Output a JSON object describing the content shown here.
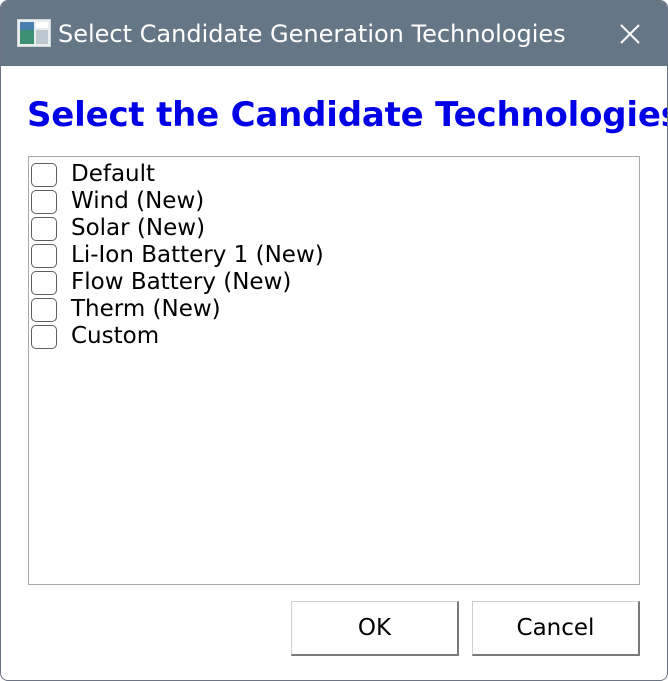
{
  "window": {
    "title": "Select Candidate Generation Technologies",
    "app_icon": "app-window-icon",
    "close_icon": "close-icon"
  },
  "heading": "Select the Candidate Technologies",
  "heading_color": "#0000e6",
  "technologies": [
    {
      "label": "Default",
      "checked": false
    },
    {
      "label": "Wind (New)",
      "checked": false
    },
    {
      "label": "Solar (New)",
      "checked": false
    },
    {
      "label": "Li-Ion Battery 1 (New)",
      "checked": false
    },
    {
      "label": "Flow Battery (New)",
      "checked": false
    },
    {
      "label": "Therm (New)",
      "checked": false
    },
    {
      "label": "Custom",
      "checked": false
    }
  ],
  "buttons": {
    "ok": "OK",
    "cancel": "Cancel"
  }
}
